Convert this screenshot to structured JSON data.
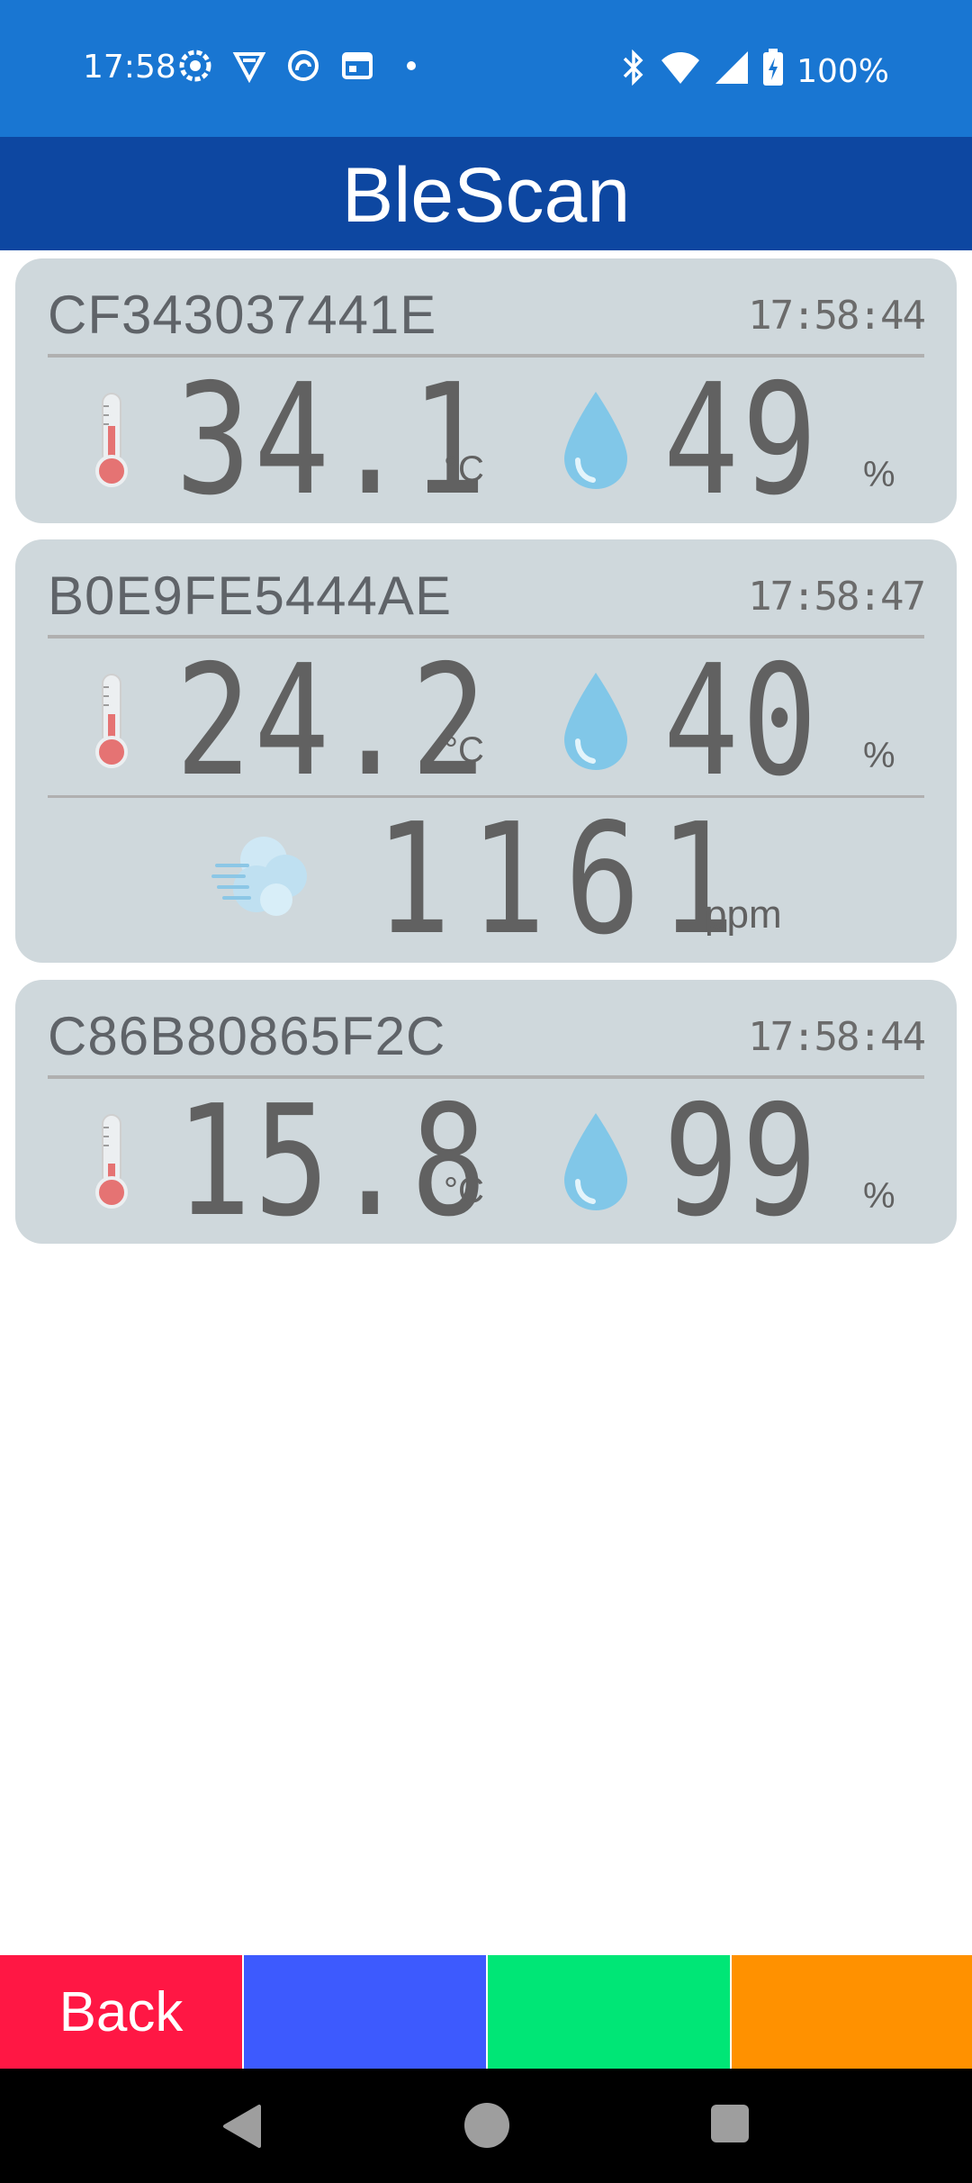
{
  "status_bar": {
    "time": "17:58",
    "battery": "100%",
    "left_icons": [
      "app-icon-1",
      "app-icon-2",
      "app-icon-3",
      "calendar-icon",
      "dot-icon"
    ],
    "right_icons": [
      "bluetooth-icon",
      "wifi-icon",
      "signal-icon",
      "battery-charging-icon"
    ]
  },
  "app_bar": {
    "title": "BleScan"
  },
  "devices": [
    {
      "id": "CF343037441E",
      "time": "17:58:44",
      "temperature": "34.1",
      "temp_unit": "°C",
      "humidity": "49",
      "hum_unit": "%"
    },
    {
      "id": "B0E9FE5444AE",
      "time": "17:58:47",
      "temperature": "24.2",
      "temp_unit": "°C",
      "humidity": "40",
      "hum_unit": "%",
      "co2": "1161",
      "co2_unit": "ppm"
    },
    {
      "id": "C86B80865F2C",
      "time": "17:58:44",
      "temperature": "15.8",
      "temp_unit": "°C",
      "humidity": "99",
      "hum_unit": "%"
    }
  ],
  "bottom_buttons": {
    "back_label": "Back",
    "colors": {
      "back": "#ff1744",
      "blue": "#3d5afe",
      "green": "#00e676",
      "orange": "#ff9100"
    }
  },
  "colors": {
    "status_bar": "#1976d2",
    "app_bar": "#0d47a1",
    "card": "#cfd8dc"
  }
}
